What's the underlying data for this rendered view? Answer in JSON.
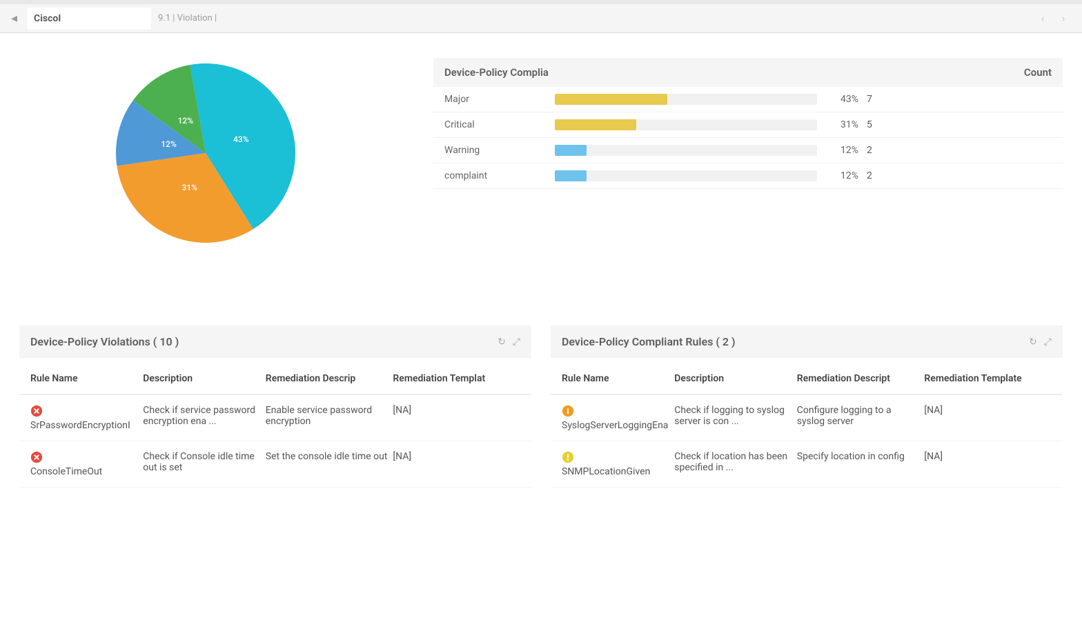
{
  "header": {
    "title": "CiscoI",
    "breadcrumb": "9.1 | Violation  |"
  },
  "chart_data": {
    "type": "pie",
    "title": "",
    "series": [
      {
        "name": "Major",
        "value": 43,
        "color": "#1bbfd6"
      },
      {
        "name": "Critical",
        "value": 31,
        "color": "#f39c2e"
      },
      {
        "name": "Warning",
        "value": 12,
        "color": "#4e99d6"
      },
      {
        "name": "complaint",
        "value": 12,
        "color": "#4cb050"
      }
    ]
  },
  "compliance": {
    "header_label": "Device-Policy Complia",
    "header_count": "Count",
    "rows": [
      {
        "name": "Major",
        "percent": 43,
        "count": 7,
        "color": "#e7ca4e"
      },
      {
        "name": "Critical",
        "percent": 31,
        "count": 5,
        "color": "#e7ca4e"
      },
      {
        "name": "Warning",
        "percent": 12,
        "count": 2,
        "color": "#6fc2ec"
      },
      {
        "name": "complaint",
        "percent": 12,
        "count": 2,
        "color": "#6fc2ec"
      }
    ]
  },
  "violations_panel": {
    "title": "Device-Policy Violations ( 10 )",
    "columns": {
      "rule": "Rule Name",
      "desc": "Description",
      "remd": "Remediation Descrip",
      "remt": "Remediation Templat"
    },
    "rows": [
      {
        "icon": "error",
        "rule": "SrPasswordEncryptionI",
        "desc": "Check if service password encryption ena ...",
        "remd": "Enable service password encryption",
        "remt": "[NA]"
      },
      {
        "icon": "error",
        "rule": "ConsoleTimeOut",
        "desc": "Check if Console idle time out is set",
        "remd": "Set the console idle time out",
        "remt": "[NA]"
      }
    ]
  },
  "compliant_panel": {
    "title": "Device-Policy Compliant Rules ( 2 )",
    "columns": {
      "rule": "Rule Name",
      "desc": "Description",
      "remd": "Remediation Descript",
      "remt": "Remediation Template"
    },
    "rows": [
      {
        "icon": "warn-orange",
        "rule": "SyslogServerLoggingEna",
        "desc": "Check if logging to syslog server is con ...",
        "remd": "Configure logging to a syslog server",
        "remt": "[NA]"
      },
      {
        "icon": "warn-yellow",
        "rule": "SNMPLocationGiven",
        "desc": "Check if location has been specified in  ...",
        "remd": "Specify location in config",
        "remt": "[NA]"
      }
    ]
  }
}
